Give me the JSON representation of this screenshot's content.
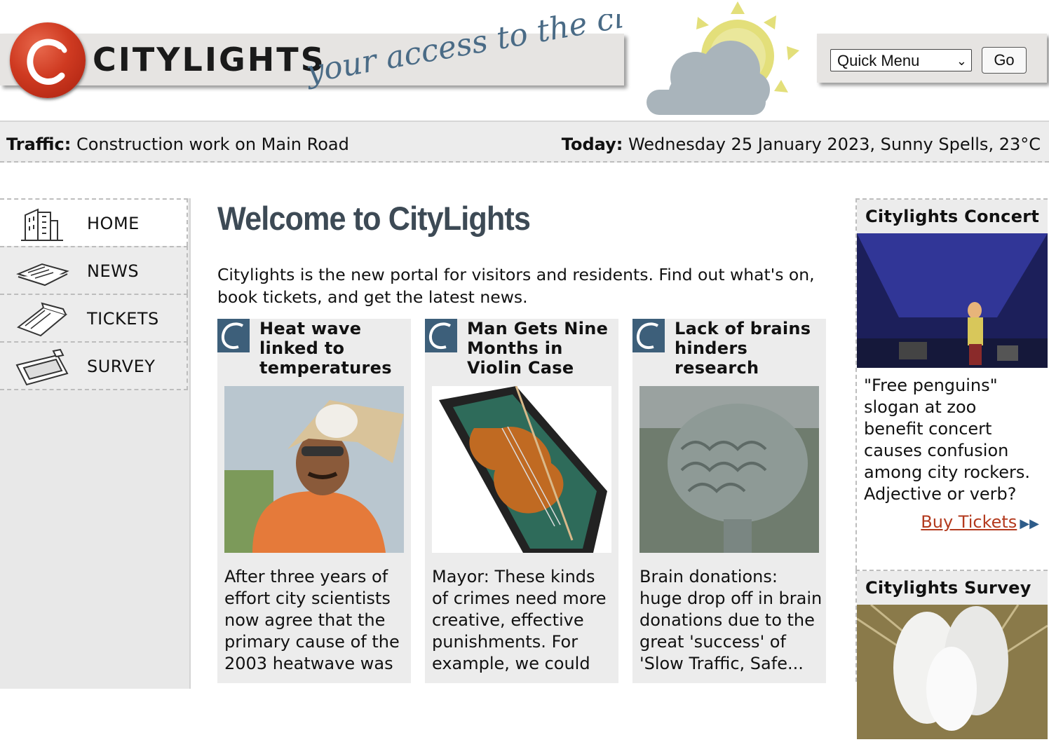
{
  "header": {
    "logo_text": "CITYLIGHTS",
    "tagline": "your access to the city",
    "quick_menu": {
      "selected": "Quick Menu",
      "go_label": "Go"
    }
  },
  "infobar": {
    "traffic_label": "Traffic:",
    "traffic_text": "Construction work on Main Road",
    "today_label": "Today:",
    "today_text": "Wednesday 25 January 2023, Sunny Spells, 23°C"
  },
  "nav": {
    "items": [
      {
        "label": "HOME",
        "icon": "building-icon"
      },
      {
        "label": "NEWS",
        "icon": "newspaper-icon"
      },
      {
        "label": "TICKETS",
        "icon": "ticket-icon"
      },
      {
        "label": "SURVEY",
        "icon": "clipboard-icon"
      }
    ]
  },
  "main": {
    "title": "Welcome to CityLights",
    "intro": "Citylights is the new portal for visitors and residents. Find out what's on, book tickets, and get the latest news.",
    "articles": [
      {
        "title": "Heat wave linked to temperatures",
        "text": "After three years of effort city scientists now agree that the primary cause of the 2003 heatwave was"
      },
      {
        "title": "Man Gets Nine Months in Violin Case",
        "text": "Mayor: These kinds of crimes need more creative, effective punishments. For example, we could"
      },
      {
        "title": "Lack of brains hinders research",
        "text": "Brain donations: huge drop off in brain donations due to the great 'success' of 'Slow Traffic, Safe..."
      }
    ]
  },
  "sidebar": {
    "concert": {
      "heading": "Citylights Concert",
      "text": "\"Free penguins\" slogan at zoo benefit concert causes confusion among city rockers. Adjective or verb?",
      "link": "Buy Tickets"
    },
    "survey": {
      "heading": "Citylights Survey"
    }
  },
  "colors": {
    "brand_red": "#cf3a21",
    "title_slate": "#3d4a55",
    "link_red": "#b33a1e",
    "sun_yellow": "#e3df7a",
    "cloud_gray": "#a9b4bb"
  }
}
